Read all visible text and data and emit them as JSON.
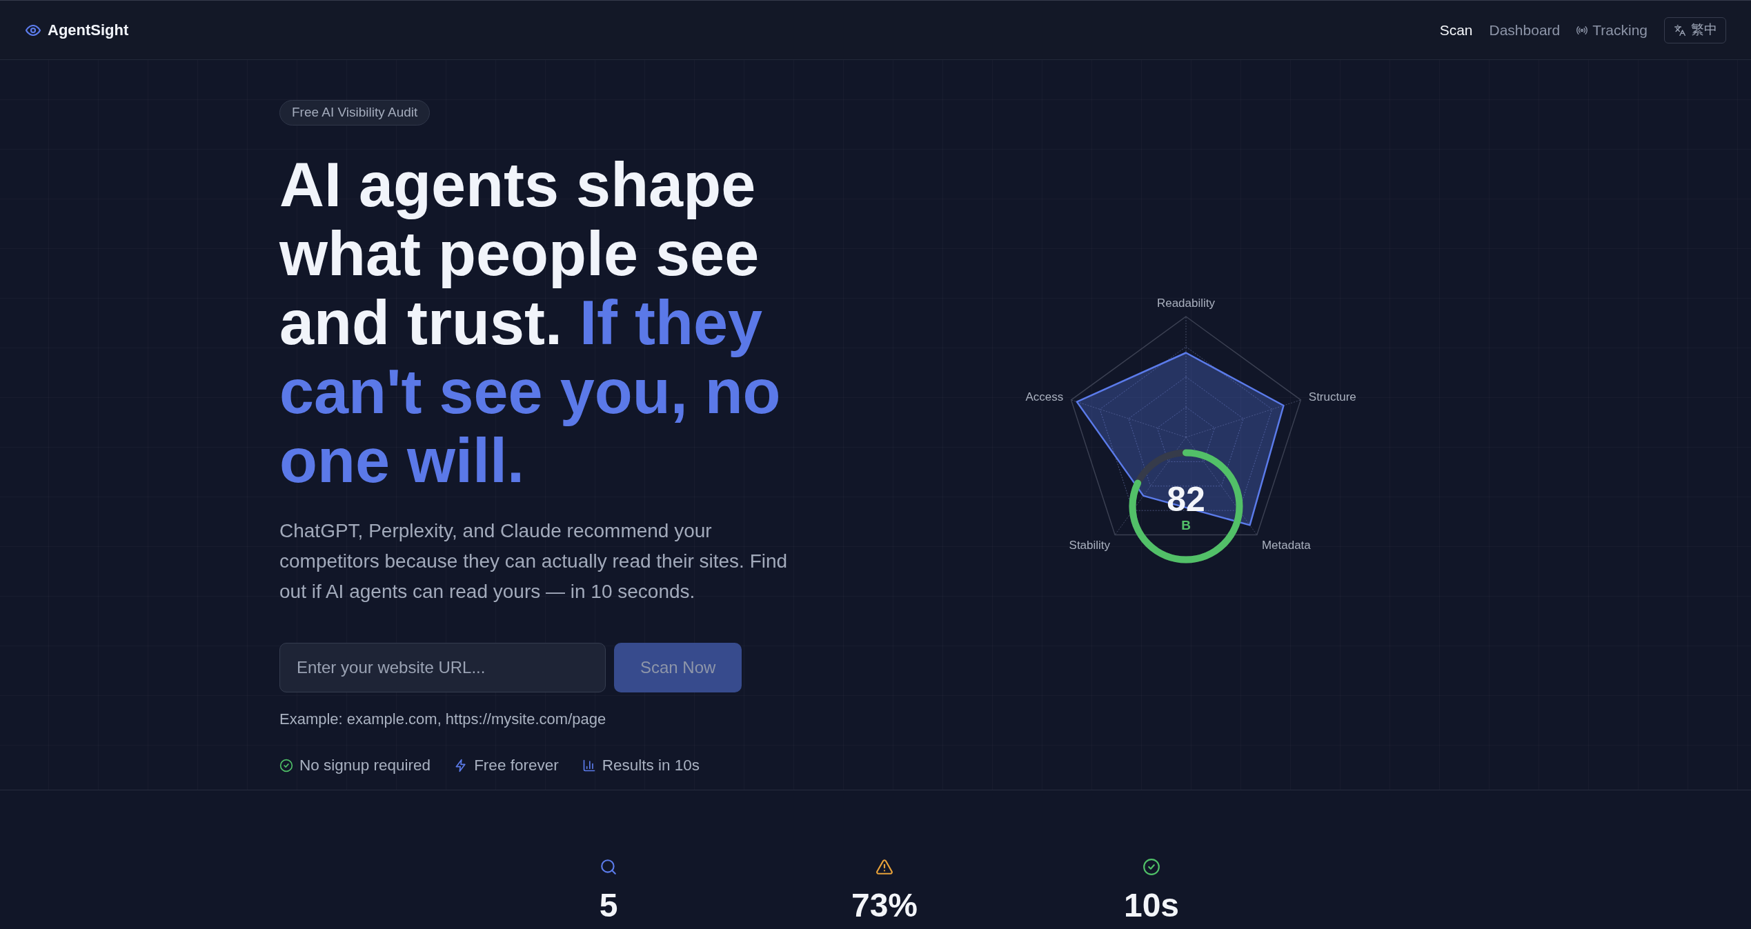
{
  "nav": {
    "brand": "AgentSight",
    "links": [
      {
        "label": "Scan",
        "selected": true,
        "kind": "text"
      },
      {
        "label": "Dashboard",
        "selected": false,
        "kind": "text"
      },
      {
        "label": "Tracking",
        "selected": false,
        "kind": "live"
      }
    ],
    "language": "繁中"
  },
  "hero": {
    "badge": "Free AI Visibility Audit",
    "heading": "AI agents shape what people see and trust.",
    "heading_highlight": "If they can't see you, no one will.",
    "intro": "ChatGPT, Perplexity, and Claude recommend your competitors because they can actually read their sites. Find out if AI agents can read yours — in 10 seconds.",
    "url_field": {
      "placeholder": "Enter your website URL..."
    },
    "scan_button": {
      "label": "Scan Now",
      "disabled": true
    },
    "example": "Example: example.com, https://mysite.com/page",
    "features": [
      "No signup required",
      "Free forever",
      "Results in 10s"
    ]
  },
  "score_card": {
    "axes": [
      "Readability",
      "Structure",
      "Metadata",
      "Stability",
      "Access"
    ],
    "score": {
      "value": "82",
      "grade": "B",
      "level": 0.82
    }
  },
  "stats": [
    {
      "value": "5"
    },
    {
      "value": "73%"
    },
    {
      "value": "10s"
    }
  ]
}
